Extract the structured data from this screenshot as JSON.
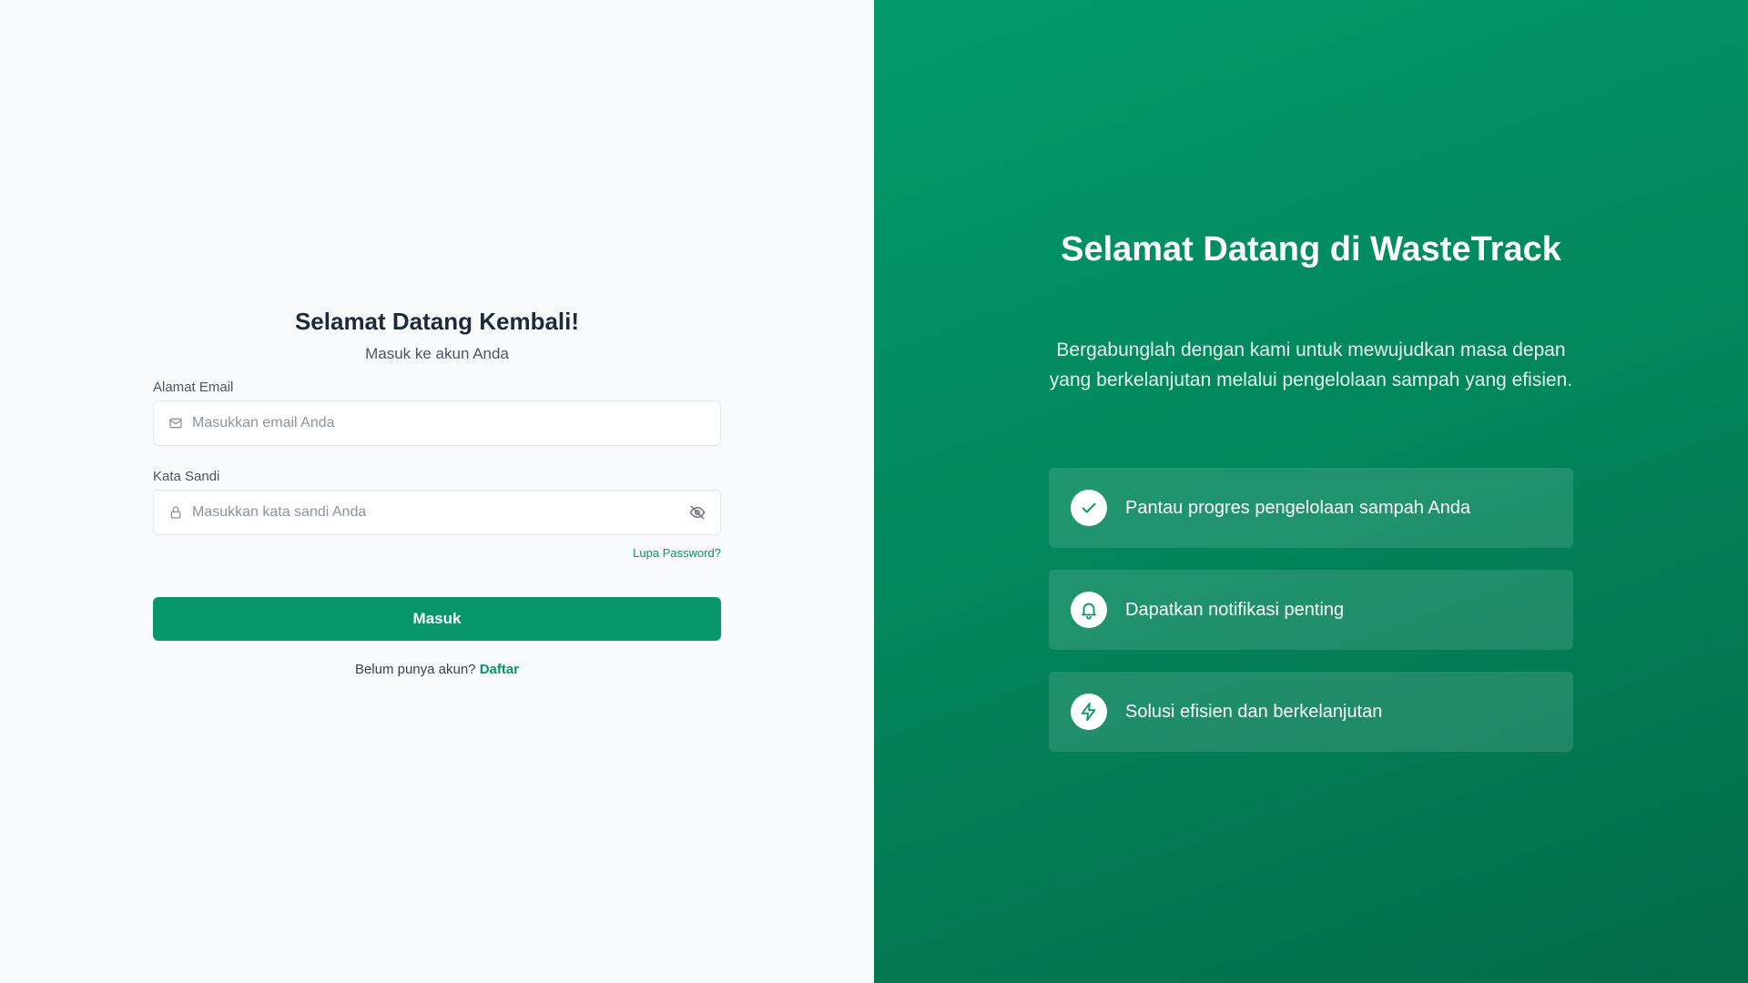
{
  "login": {
    "title": "Selamat Datang Kembali!",
    "subtitle": "Masuk ke akun Anda",
    "email_label": "Alamat Email",
    "email_placeholder": "Masukkan email Anda",
    "email_value": "",
    "password_label": "Kata Sandi",
    "password_placeholder": "Masukkan kata sandi Anda",
    "password_value": "",
    "forgot_label": "Lupa Password?",
    "submit_label": "Masuk",
    "register_prompt": "Belum punya akun?",
    "register_label": "Daftar"
  },
  "hero": {
    "title": "Selamat Datang di WasteTrack",
    "description": "Bergabunglah dengan kami untuk mewujudkan masa depan yang berkelanjutan melalui pengelolaan sampah yang efisien.",
    "features": [
      {
        "icon": "check-icon",
        "text": "Pantau progres pengelolaan sampah Anda"
      },
      {
        "icon": "bell-icon",
        "text": "Dapatkan notifikasi penting"
      },
      {
        "icon": "lightning-icon",
        "text": "Solusi efisien dan berkelanjutan"
      }
    ]
  },
  "colors": {
    "primary": "#059669",
    "background_left": "#f8fafc",
    "title_text": "#1e293b"
  },
  "icons": {
    "email_field": "mail-icon",
    "password_field": "lock-icon",
    "password_toggle": "eye-off-icon"
  }
}
